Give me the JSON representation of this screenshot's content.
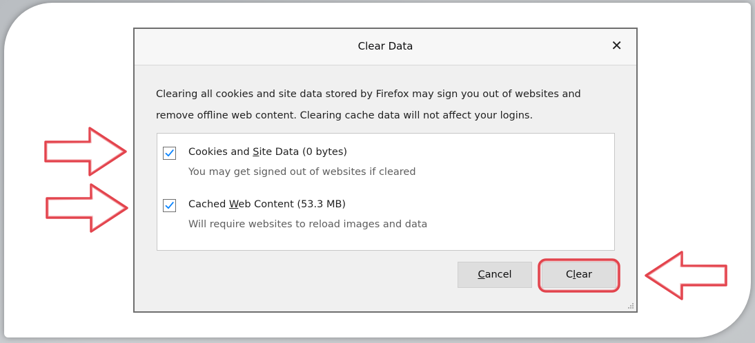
{
  "dialog": {
    "title": "Clear Data",
    "close_glyph": "✕",
    "description_line1": "Clearing all cookies and site data stored by Firefox may sign you out of websites and",
    "description_line2": "remove offline web content. Clearing cache data will not affect your logins."
  },
  "options": [
    {
      "label_before": "Cookies and ",
      "label_accel": "S",
      "label_after": "ite Data (0 bytes)",
      "subtext": "You may get signed out of websites if cleared",
      "checked": true
    },
    {
      "label_before": "Cached ",
      "label_accel": "W",
      "label_after": "eb Content (53.3 MB)",
      "subtext": "Will require websites to reload images and data",
      "checked": true
    }
  ],
  "buttons": {
    "cancel_accel": "C",
    "cancel_rest": "ancel",
    "clear_before": "C",
    "clear_accel": "l",
    "clear_after": "ear"
  },
  "colors": {
    "checkmark": "#0a84ff",
    "annotation": "#e0303a"
  },
  "icons": {
    "close": "close-icon",
    "check": "checkmark-icon",
    "annotation_arrow": "annotation-arrow-icon",
    "resize": "resize-grip-icon"
  }
}
